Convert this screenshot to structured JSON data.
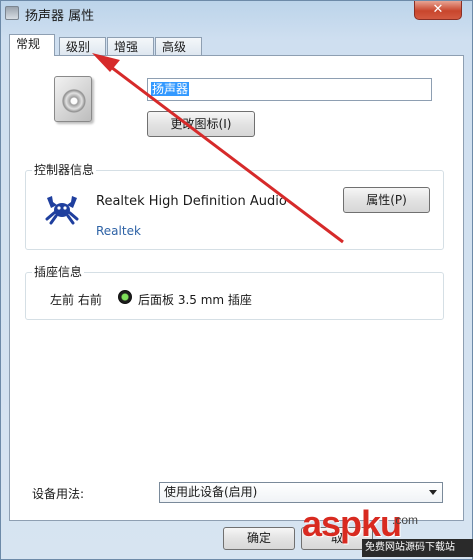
{
  "window": {
    "title": "扬声器 属性",
    "close_glyph": "✕"
  },
  "tabs": [
    {
      "label": "常规",
      "active": true
    },
    {
      "label": "级别",
      "active": false
    },
    {
      "label": "增强",
      "active": false
    },
    {
      "label": "高级",
      "active": false
    }
  ],
  "general": {
    "device_name": "扬声器",
    "change_icon_label": "更改图标(I)"
  },
  "controller": {
    "group_label": "控制器信息",
    "name": "Realtek High Definition Audio",
    "vendor": "Realtek",
    "properties_label": "属性(P)"
  },
  "jack": {
    "group_label": "插座信息",
    "position": "左前 右前",
    "description": "后面板 3.5 mm 插座"
  },
  "device_usage": {
    "label": "设备用法:",
    "selected": "使用此设备(启用)"
  },
  "footer": {
    "ok_label": "确定",
    "cancel_label": "取"
  },
  "watermark": {
    "main": "aspku",
    "sub": ".com",
    "caption": "免费网站源码下载站"
  },
  "colors": {
    "annotation_arrow": "#d62a2a",
    "selection": "#3399ff",
    "vendor_link": "#2f63a6"
  }
}
